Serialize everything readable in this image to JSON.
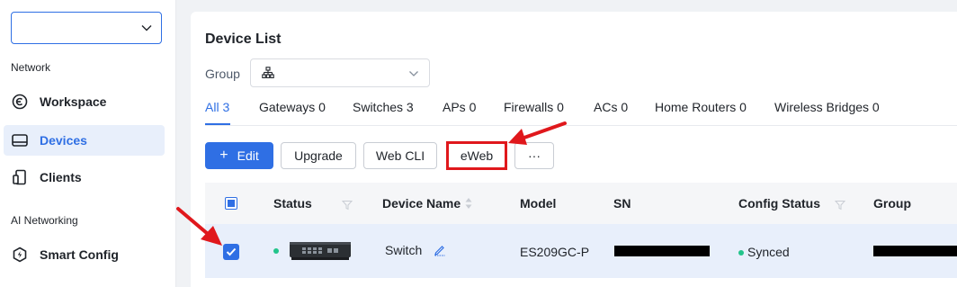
{
  "sidebar": {
    "project_select": {
      "value": "",
      "placeholder": ""
    },
    "sections": [
      "Network",
      "AI Networking"
    ],
    "items": [
      {
        "label": "Workspace",
        "icon": "workspace-icon"
      },
      {
        "label": "Devices",
        "icon": "devices-icon",
        "active": true
      },
      {
        "label": "Clients",
        "icon": "clients-icon"
      },
      {
        "label": "Smart Config",
        "icon": "smart-config-icon"
      }
    ]
  },
  "main": {
    "title": "Device List",
    "group_label": "Group",
    "tabs": [
      {
        "label": "All 3",
        "active": true
      },
      {
        "label": "Gateways 0"
      },
      {
        "label": "Switches 3"
      },
      {
        "label": "APs 0"
      },
      {
        "label": "Firewalls 0"
      },
      {
        "label": "ACs 0"
      },
      {
        "label": "Home Routers 0"
      },
      {
        "label": "Wireless Bridges 0"
      }
    ],
    "toolbar": {
      "edit_label": "Edit",
      "edit_icon": "+",
      "upgrade_label": "Upgrade",
      "webcli_label": "Web CLI",
      "eweb_label": "eWeb",
      "more_label": "···"
    },
    "table": {
      "columns": [
        "Status",
        "Device Name",
        "Model",
        "SN",
        "Config Status",
        "Group"
      ],
      "rows": [
        {
          "device_name": "Switch",
          "model": "ES209GC-P",
          "config_status": "Synced",
          "selected": true
        }
      ]
    }
  },
  "colors": {
    "accent": "#2f6fe4",
    "annotation": "#e0181c",
    "online": "#22c48b"
  }
}
